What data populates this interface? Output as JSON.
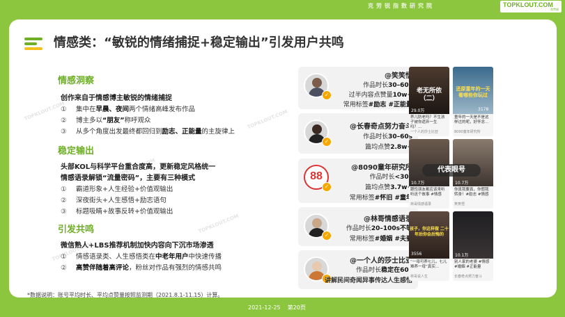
{
  "header": {
    "institute": "克劳锐指数研究院",
    "logo_main": "TOPKLOUT.COM",
    "logo_sub": "克劳锐"
  },
  "title": "情感类：“敏锐的情绪捕捉+稳定输出”引发用户共鸣",
  "sections": [
    {
      "heading": "情感洞察",
      "lead": "创作来自于情感博主敏锐的情绪捕捉",
      "items": [
        {
          "num": "①",
          "pre": "集中在",
          "b1": "早晨、夜间",
          "post": "两个情绪高峰发布作品"
        },
        {
          "num": "②",
          "pre": "博主多以",
          "b1": "“朋友”",
          "post": "称呼观众"
        },
        {
          "num": "③",
          "pre": "从多个角度出发最终都回归到",
          "b1": "励志、正能量",
          "post": "的主旋律上"
        }
      ]
    },
    {
      "heading": "稳定输出",
      "lead": "头部KOL与科学平台重合度高，更新稳定风格统一",
      "lead2": "情感语录解锁“流量密码”，主要有三种模式",
      "items": [
        {
          "num": "①",
          "pre": "霸道形象+人生经验+价值观输出",
          "b1": "",
          "post": ""
        },
        {
          "num": "②",
          "pre": "深夜街头+人生感悟+励志语句",
          "b1": "",
          "post": ""
        },
        {
          "num": "③",
          "pre": "标题吸睛+故事反转+价值观输出",
          "b1": "",
          "post": ""
        }
      ]
    },
    {
      "heading": "引发共鸣",
      "lead": "微信熟人+LBS推荐机制加快内容向下沉市场渗透",
      "items": [
        {
          "num": "①",
          "pre": "情感语录类、人生感悟类在",
          "b1": "中老年用户",
          "post": "中快速传播"
        },
        {
          "num": "②",
          "pre": "",
          "b1": "高赞伴随着高评论",
          "post": "，粉丝对作品有强烈的情感共鸣"
        }
      ]
    }
  ],
  "note": "*数据说明：账号平均时长、平均点赞量按照监测期（2021.8.1-11.15）计算。",
  "profiles": [
    {
      "name": "@笑笑悟",
      "lines": [
        {
          "label": "作品时长",
          "value": "30–60s"
        },
        {
          "label": "过半内容点赞量",
          "value": "10w+"
        },
        {
          "label": "常用标签",
          "value": "#励志 #正能量"
        }
      ]
    },
    {
      "name": "@长春奇点努力奋斗",
      "lines": [
        {
          "label": "作品时长",
          "value": "30–60s"
        },
        {
          "label": "篇均点赞",
          "value": "2.8w+"
        }
      ]
    },
    {
      "name": "@8090童年研究所",
      "brand": "88",
      "lines": [
        {
          "label": "作品时长",
          "value": "<30s"
        },
        {
          "label": "篇均点赞",
          "value": "3.7w+"
        },
        {
          "label": "常用标签",
          "value": "#怀旧 #童年"
        }
      ]
    },
    {
      "name": "@林哥情感语录",
      "lines": [
        {
          "label": "作品时长",
          "value": "20–100s不等"
        },
        {
          "label": "常用标签",
          "value": "#婚姻 #夫妻"
        }
      ]
    },
    {
      "name": "@一个人的莎士比亚",
      "lines": [
        {
          "label": "作品时长",
          "value": "稳定在60s"
        },
        {
          "label": "讲解民间奇闻异事传达人生感悟",
          "value": ""
        }
      ]
    }
  ],
  "thumbs": [
    {
      "overlay": "老无所依（二）",
      "count": "29.0万",
      "caption": "养儿防老吗？不生孩子被你遗弃一生吗？…",
      "author": "一个人的莎士比亚"
    },
    {
      "overlay": "还原童年的一天 看哪些你玩过",
      "count": "3178",
      "caption": "童年的一天是不是这样过的呢，好怀念…",
      "author": "8090童年研究所"
    },
    {
      "overlay": "代表眼号",
      "count": "10.7万",
      "caption": "跟性朋友都应该来听听这个故事 #情感",
      "author": "林哥情感语录"
    },
    {
      "overlay": "",
      "count": "10.7万",
      "caption": "你真我要真，你假我转身！#励志 #情感",
      "author": "笑笑悟"
    },
    {
      "overlay": "孩子，你这样做 二十年后你会后悔的",
      "count": "3556",
      "caption": "“一母可养七儿，七儿难养一母”真实…",
      "author": "林哥说人生"
    },
    {
      "overlay": "",
      "count": "10.1万",
      "caption": "别人家的老婆 #情感 #婚姻 #正能量",
      "author": "长春奇点努力奋斗"
    }
  ],
  "footer": {
    "date": "2021-12-25",
    "page": "第20页"
  },
  "colors": {
    "brand_green": "#8cc63f",
    "heading_green": "#6fae27",
    "badge_orange": "#f7a800"
  }
}
